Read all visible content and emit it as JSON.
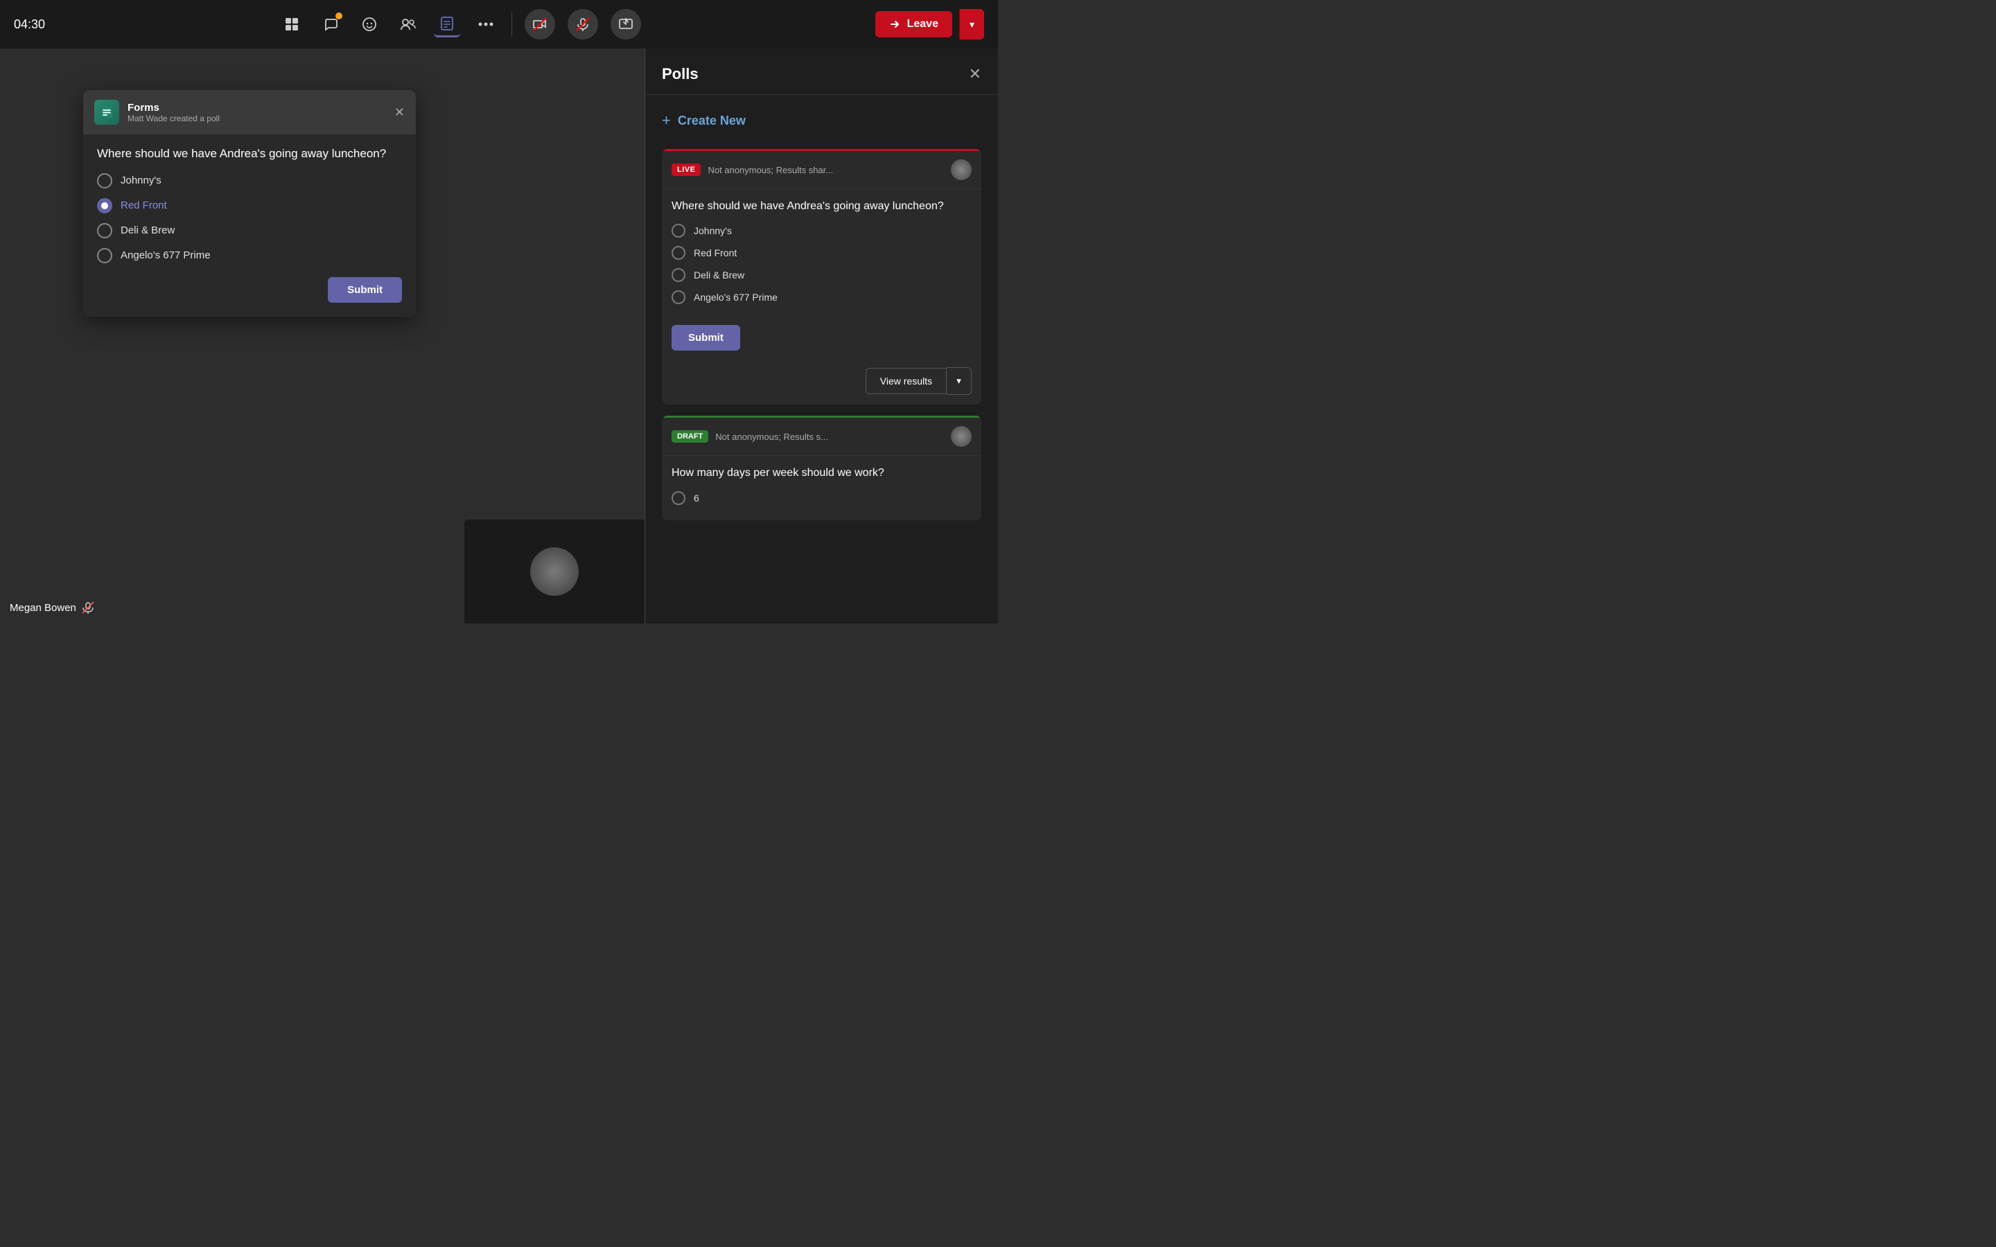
{
  "topbar": {
    "timer": "04:30",
    "icons": [
      {
        "name": "grid-icon",
        "label": "Grid",
        "active": false,
        "badge": false
      },
      {
        "name": "chat-icon",
        "label": "Chat",
        "active": false,
        "badge": true
      },
      {
        "name": "emoji-icon",
        "label": "Reactions",
        "active": false,
        "badge": false
      },
      {
        "name": "participants-icon",
        "label": "Participants",
        "active": false,
        "badge": false
      },
      {
        "name": "forms-icon",
        "label": "Forms",
        "active": true,
        "badge": false
      },
      {
        "name": "more-icon",
        "label": "More",
        "active": false,
        "badge": false
      }
    ],
    "media_buttons": [
      {
        "name": "video-off-btn",
        "icon": "🎥",
        "off": true
      },
      {
        "name": "mic-off-btn",
        "icon": "🎤",
        "off": true
      },
      {
        "name": "share-screen-btn",
        "icon": "⬆",
        "off": false
      }
    ],
    "leave_button": "Leave"
  },
  "poll_popup": {
    "app_name": "Forms",
    "subtitle": "Matt Wade created a poll",
    "question": "Where should we have Andrea's going away luncheon?",
    "options": [
      {
        "id": "johnnys",
        "text": "Johnny's",
        "selected": false
      },
      {
        "id": "redfront",
        "text": "Red Front",
        "selected": true
      },
      {
        "id": "delibrew",
        "text": "Deli & Brew",
        "selected": false
      },
      {
        "id": "angelo",
        "text": "Angelo's 677 Prime",
        "selected": false
      }
    ],
    "submit_label": "Submit"
  },
  "polls_panel": {
    "title": "Polls",
    "create_new_label": "Create New",
    "live_card": {
      "badge": "LIVE",
      "meta": "Not anonymous; Results shar...",
      "question": "Where should we have Andrea's going away luncheon?",
      "options": [
        {
          "text": "Johnny's"
        },
        {
          "text": "Red Front"
        },
        {
          "text": "Deli & Brew"
        },
        {
          "text": "Angelo's 677 Prime"
        }
      ],
      "submit_label": "Submit",
      "view_results_label": "View results"
    },
    "draft_card": {
      "badge": "DRAFT",
      "meta": "Not anonymous; Results s...",
      "question": "How many days per week should we work?",
      "option_number": "6"
    }
  },
  "user": {
    "name": "Megan Bowen"
  }
}
